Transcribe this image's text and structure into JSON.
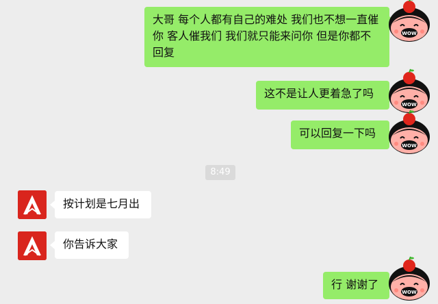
{
  "chat": {
    "timestamp": "8:49",
    "messages": [
      {
        "side": "right",
        "text": "大哥 每个人都有自己的难处 我们也不想一直催你 客人催我们 我们就只能来问你 但是你都不回复"
      },
      {
        "side": "right",
        "text": "这不是让人更着急了吗"
      },
      {
        "side": "right",
        "text": "可以回复一下吗"
      },
      {
        "side": "left",
        "text": "按计划是七月出"
      },
      {
        "side": "left",
        "text": "你告诉大家"
      },
      {
        "side": "right",
        "text": "行 谢谢了"
      }
    ]
  },
  "avatars": {
    "self_label": "WOW",
    "self_icon": "cartoon-girl-with-apple-avatar",
    "contact_icon": "red-white-logo-avatar"
  },
  "colors": {
    "background": "#ededed",
    "bubble_self": "#95ec69",
    "bubble_other": "#ffffff",
    "contact_avatar": "#d9251d"
  }
}
